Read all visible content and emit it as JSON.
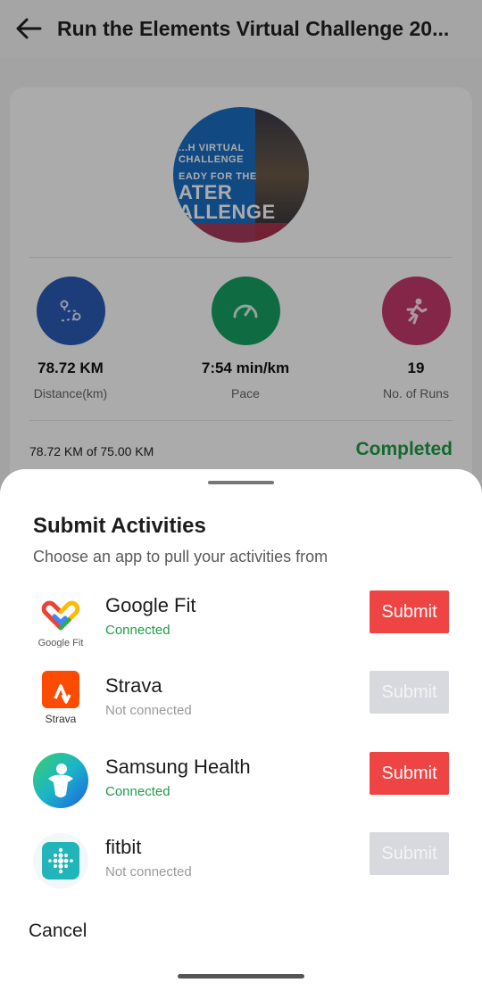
{
  "header": {
    "title": "Run the Elements Virtual Challenge 20..."
  },
  "challenge_card": {
    "banner_text": {
      "line1": "...H VIRTUAL",
      "line2": "CHALLENGE",
      "line3": "EADY FOR THE",
      "line4": "ATER",
      "line5": "ALLENGE"
    },
    "stats": [
      {
        "value": "78.72 KM",
        "label": "Distance(km)",
        "icon": "route-icon",
        "color": "#2b5bb5"
      },
      {
        "value": "7:54 min/km",
        "label": "Pace",
        "icon": "speedometer-icon",
        "color": "#17a163"
      },
      {
        "value": "19",
        "label": "No. of Runs",
        "icon": "runner-icon",
        "color": "#c43a6a"
      }
    ],
    "progress_text": "78.72 KM of 75.00 KM",
    "progress_status": "Completed"
  },
  "sheet": {
    "title": "Submit Activities",
    "subtitle": "Choose an app to pull your activities from",
    "apps": [
      {
        "name": "Google Fit",
        "status": "Connected",
        "logo_caption": "Google Fit",
        "submit_label": "Submit",
        "enabled": true
      },
      {
        "name": "Strava",
        "status": "Not connected",
        "logo_caption": "Strava",
        "submit_label": "Submit",
        "enabled": false
      },
      {
        "name": "Samsung Health",
        "status": "Connected",
        "submit_label": "Submit",
        "enabled": true
      },
      {
        "name": "fitbit",
        "status": "Not connected",
        "submit_label": "Submit",
        "enabled": false
      }
    ],
    "cancel_label": "Cancel"
  },
  "colors": {
    "submit_active": "#ef4444",
    "submit_disabled": "#d7d9de",
    "connected": "#1f9d48",
    "completed": "#1f9d48"
  }
}
